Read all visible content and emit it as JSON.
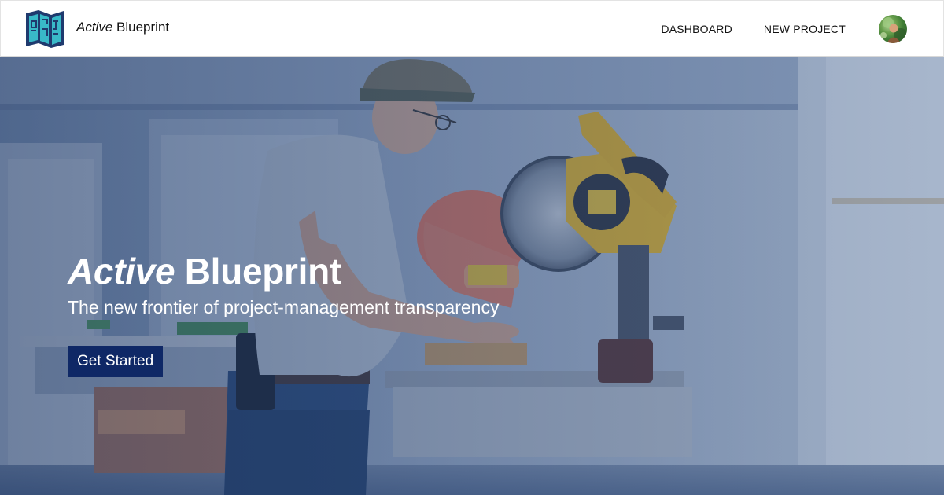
{
  "brand": {
    "name_italic": "Active",
    "name_rest": "Blueprint",
    "logo_icon": "blueprint-map-icon"
  },
  "nav": {
    "items": [
      {
        "label": "DASHBOARD"
      },
      {
        "label": "NEW PROJECT"
      }
    ],
    "avatar_icon": "user-avatar"
  },
  "hero": {
    "title_italic": "Active",
    "title_rest": "Blueprint",
    "subtitle": "The new frontier of project-management transparency",
    "cta_label": "Get Started",
    "background": "photo of workers cutting wood with a miter saw, blue tint"
  },
  "colors": {
    "brand_navy": "#0f2866",
    "logo_navy": "#1f3a6e",
    "logo_teal": "#39b9c8",
    "overlay_blue": "#1b3461",
    "header_bg": "#ffffff"
  }
}
